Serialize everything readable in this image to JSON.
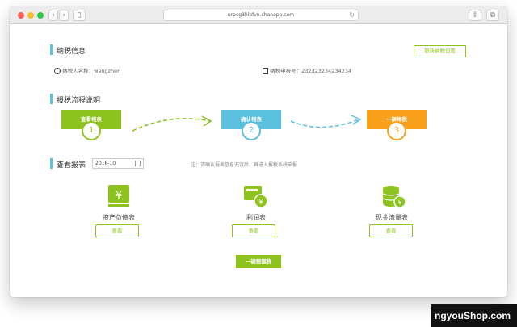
{
  "browser": {
    "url": "urpcg3hlbfvn.chanapp.com",
    "back_glyph": "‹",
    "forward_glyph": "›",
    "sidebar_glyph": "▯",
    "reload_glyph": "↻",
    "share_glyph": "⇧",
    "tabs_glyph": "⧉"
  },
  "tax_info": {
    "title": "纳税信息",
    "taxpayer_label": "纳税人名称：",
    "taxpayer_name": "wangzhen",
    "filing_label": "纳税申报号：",
    "filing_number": "232323234234234",
    "update_button": "更新纳税设置"
  },
  "process": {
    "title": "报税流程说明",
    "steps": [
      {
        "label": "查看报表",
        "number": "1",
        "color": "#8dc21f"
      },
      {
        "label": "确认报表",
        "number": "2",
        "color": "#5bc0de"
      },
      {
        "label": "一键报税",
        "number": "3",
        "color": "#f9a11b"
      }
    ]
  },
  "reports": {
    "title": "查看报表",
    "date_value": "2016-10",
    "note": "注：请确认报表信息无误后，再进入报税系统申报",
    "items": [
      {
        "name": "资产负债表",
        "button": "查看",
        "icon": "balance-sheet-icon"
      },
      {
        "name": "利润表",
        "button": "查看",
        "icon": "profit-statement-icon"
      },
      {
        "name": "现金流量表",
        "button": "查看",
        "icon": "cash-flow-icon"
      }
    ],
    "submit_button": "一键报国税"
  },
  "colors": {
    "green": "#8dc21f",
    "blue": "#5bc0de",
    "orange": "#f9a11b"
  },
  "watermark": "ngyouShop.com"
}
